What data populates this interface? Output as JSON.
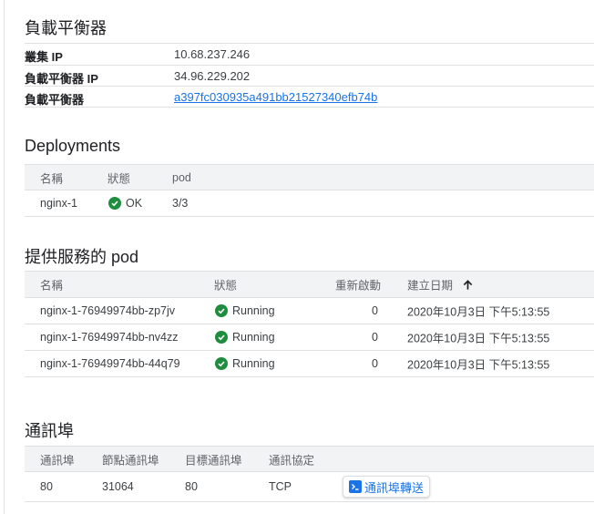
{
  "lb_section": {
    "title": "負載平衡器",
    "rows": [
      {
        "key": "叢集 IP",
        "value": "10.68.237.246",
        "link": false
      },
      {
        "key": "負載平衡器 IP",
        "value": "34.96.229.202",
        "link": false
      },
      {
        "key": "負載平衡器",
        "value": "a397fc030935a491bb21527340efb74b",
        "link": true
      }
    ]
  },
  "deployments": {
    "title": "Deployments",
    "headers": {
      "name": "名稱",
      "status": "狀態",
      "pod": "pod"
    },
    "rows": [
      {
        "name": "nginx-1",
        "status": "OK",
        "pod": "3/3"
      }
    ]
  },
  "pods": {
    "title": "提供服務的 pod",
    "headers": {
      "name": "名稱",
      "status": "狀態",
      "restarts": "重新啟動",
      "created": "建立日期"
    },
    "sort_icon": "arrow-up-icon",
    "rows": [
      {
        "name": "nginx-1-76949974bb-zp7jv",
        "status": "Running",
        "restarts": "0",
        "created": "2020年10月3日 下午5:13:55"
      },
      {
        "name": "nginx-1-76949974bb-nv4zz",
        "status": "Running",
        "restarts": "0",
        "created": "2020年10月3日 下午5:13:55"
      },
      {
        "name": "nginx-1-76949974bb-44q79",
        "status": "Running",
        "restarts": "0",
        "created": "2020年10月3日 下午5:13:55"
      }
    ]
  },
  "ports": {
    "title": "通訊埠",
    "headers": {
      "port": "通訊埠",
      "node_port": "節點通訊埠",
      "target_port": "目標通訊埠",
      "protocol": "通訊協定"
    },
    "rows": [
      {
        "port": "80",
        "node_port": "31064",
        "target_port": "80",
        "protocol": "TCP",
        "action": "通訊埠轉送"
      }
    ]
  },
  "colors": {
    "accent": "#1a73e8",
    "ok": "#1e8e3e",
    "header_bg": "#f1f3f4"
  }
}
